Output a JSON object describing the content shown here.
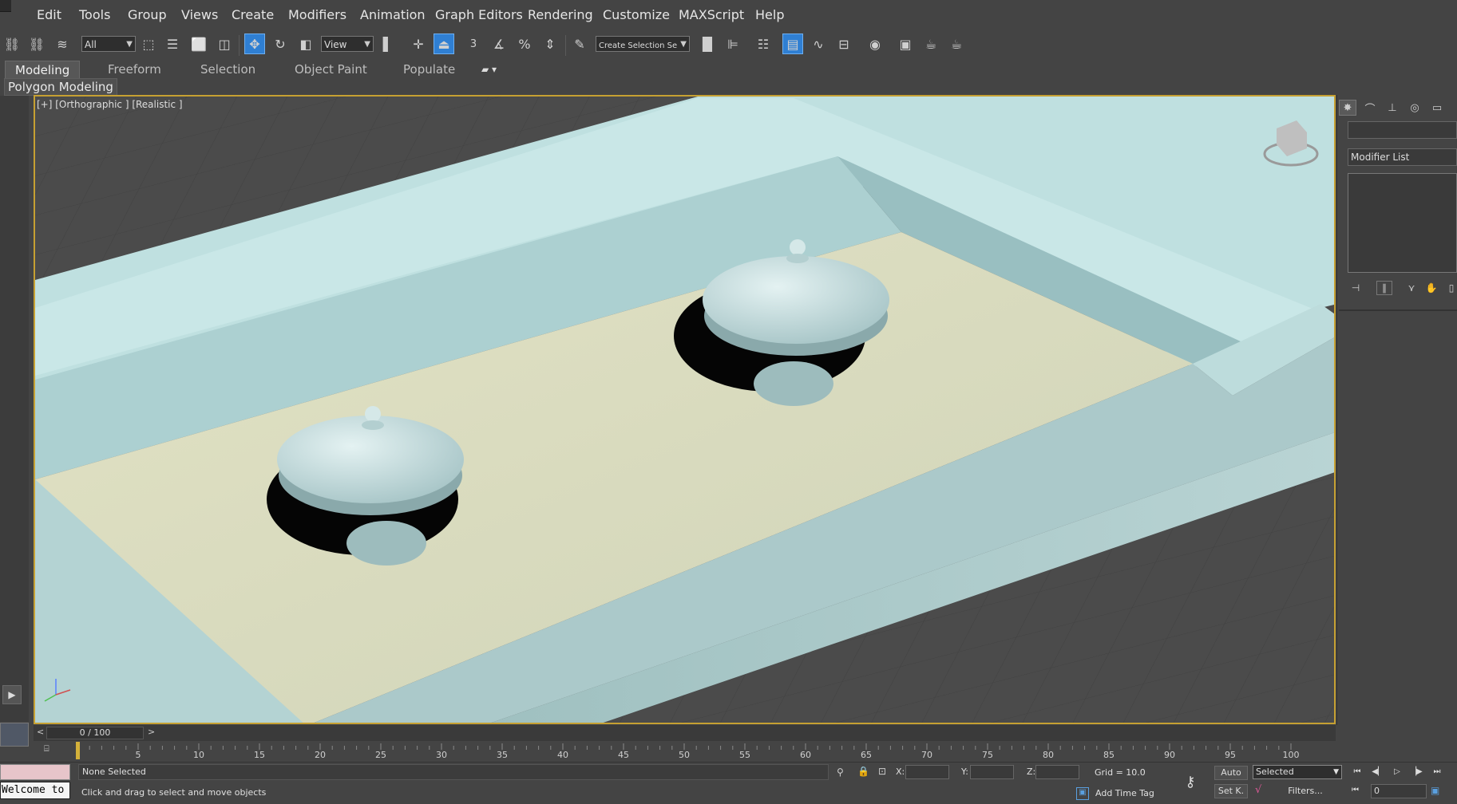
{
  "menu": {
    "items": [
      "Edit",
      "Tools",
      "Group",
      "Views",
      "Create",
      "Modifiers",
      "Animation",
      "Graph Editors",
      "Rendering",
      "Customize",
      "MAXScript",
      "Help"
    ]
  },
  "toolbar": {
    "selection_filter": "All",
    "ref_coord": "View",
    "named_selection": "Create Selection Se",
    "snap_3": "3",
    "angle_snap": "%"
  },
  "ribbon": {
    "tabs": [
      "Modeling",
      "Freeform",
      "Selection",
      "Object Paint",
      "Populate"
    ],
    "active_tab": "Modeling",
    "panel_label": "Polygon Modeling"
  },
  "viewport": {
    "label": "[+] [Orthographic ] [Realistic ]",
    "colors": {
      "border": "#c6a032",
      "background": "#474747",
      "frame_top": "#c7e6e6",
      "frame_side": "#9bbcbf",
      "floor": "#dcdcc0"
    }
  },
  "command_panel": {
    "modifier_list": "Modifier List"
  },
  "timeline": {
    "slider_text": "0 / 100",
    "ticks": [
      "5",
      "10",
      "15",
      "20",
      "25",
      "30",
      "35",
      "40",
      "45",
      "50",
      "55",
      "60",
      "65",
      "70",
      "75",
      "80",
      "85",
      "90",
      "95",
      "100"
    ]
  },
  "status": {
    "selection": "None Selected",
    "prompt": "Click and drag to select and move objects",
    "welcome": "Welcome to",
    "x_label": "X:",
    "y_label": "Y:",
    "z_label": "Z:",
    "grid": "Grid = 10.0",
    "add_time_tag": "Add Time Tag",
    "auto_key": "Auto",
    "set_key": "Set K.",
    "key_filter": "Selected",
    "filters": "Filters...",
    "current_frame": "0"
  }
}
